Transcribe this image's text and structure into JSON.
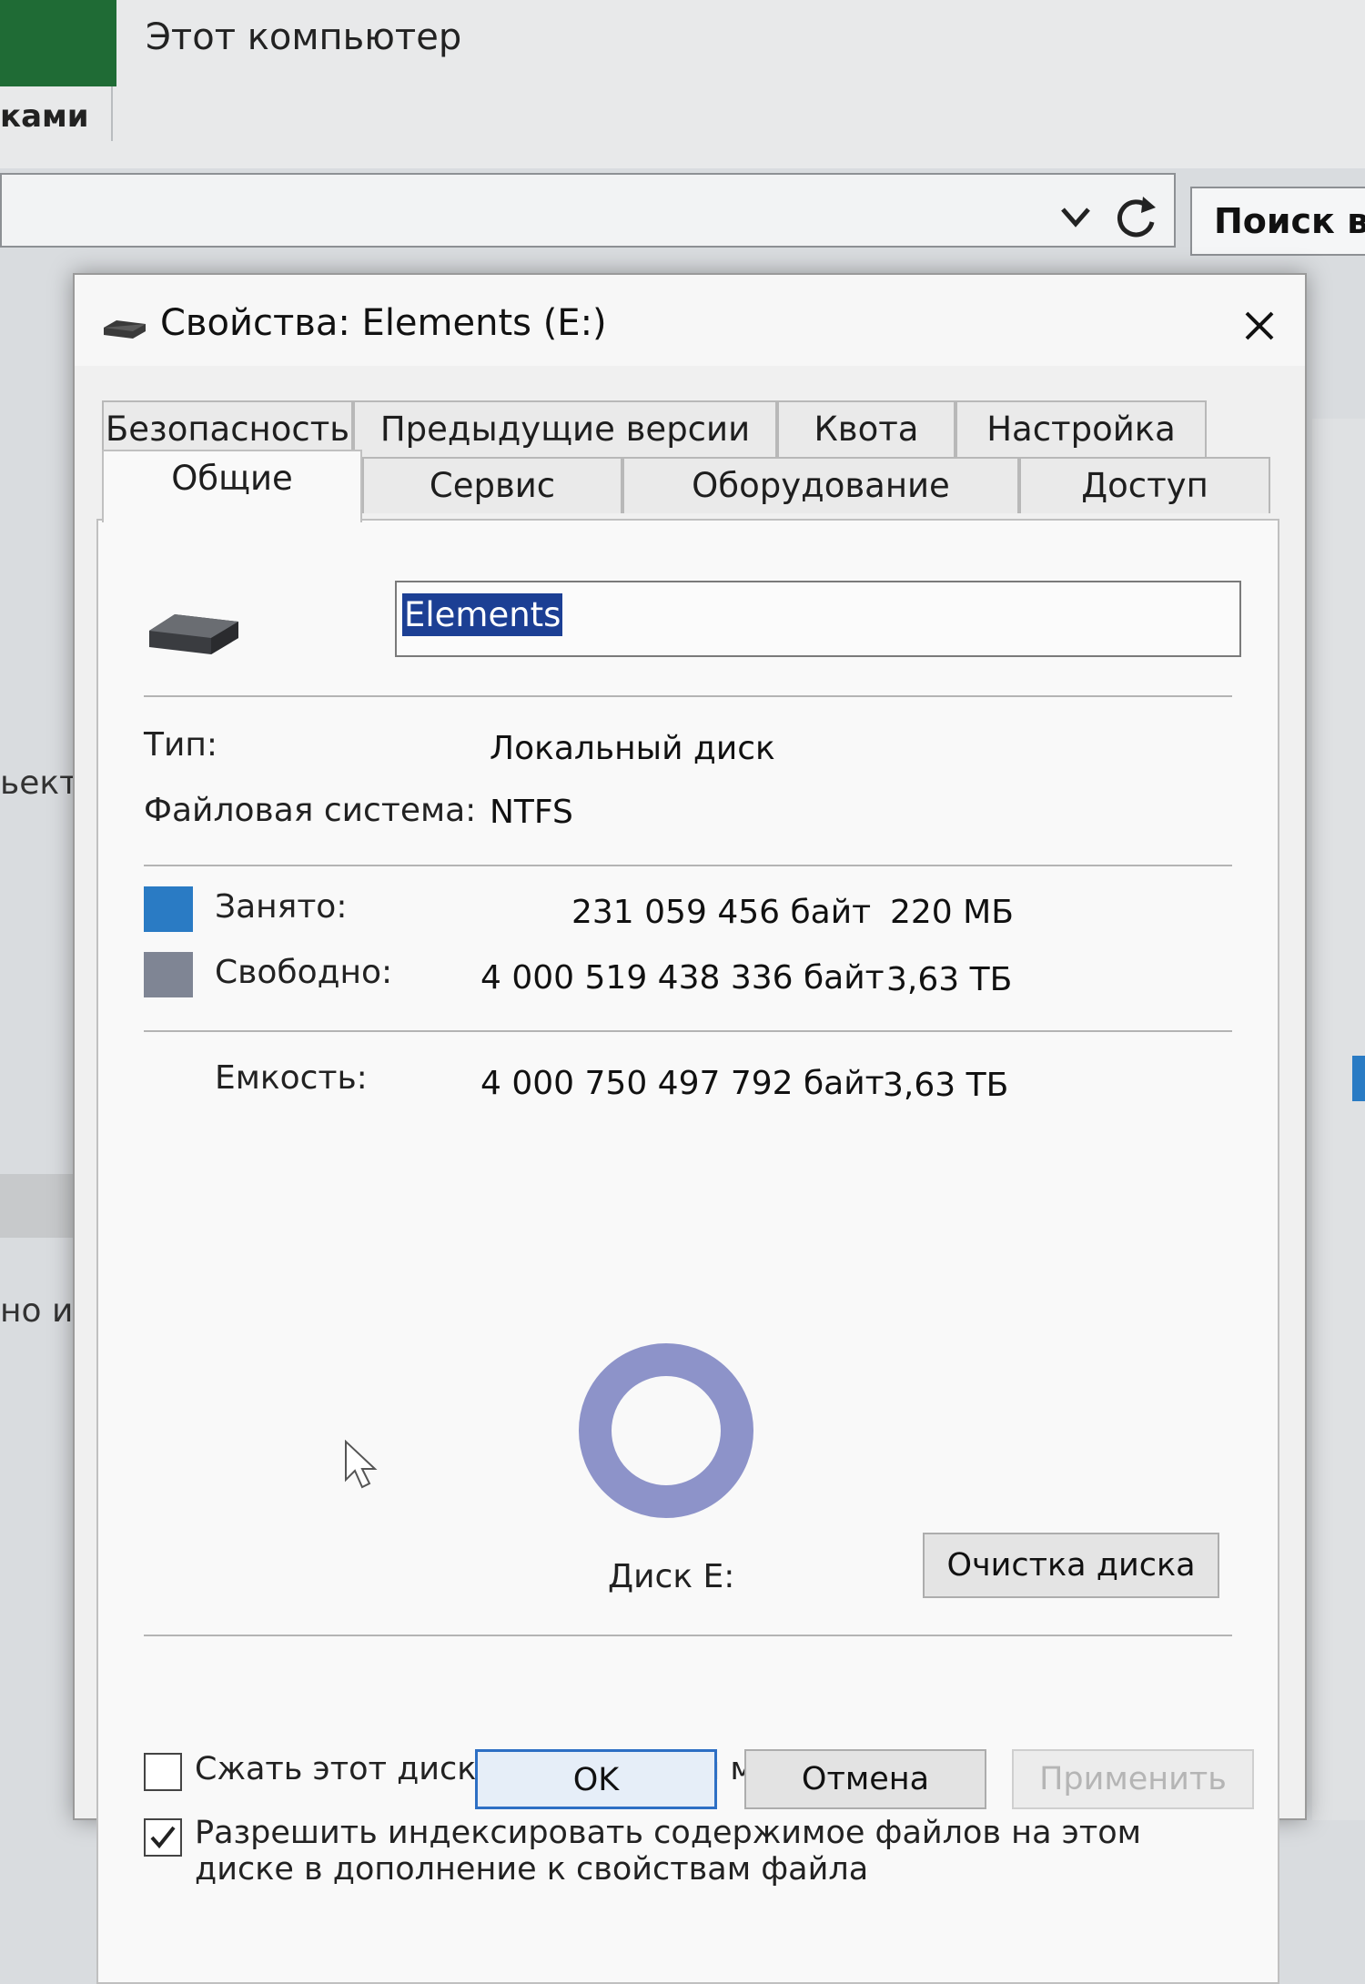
{
  "background": {
    "window_title": "Этот компьютер",
    "ribbon_tab_fragment": "ками",
    "search_placeholder": "Поиск в:",
    "left_fragment_1": "ьект",
    "left_fragment_2": "но и"
  },
  "dialog": {
    "title": "Свойства: Elements (E:)",
    "tabs_row1": [
      "Безопасность",
      "Предыдущие версии",
      "Квота",
      "Настройка"
    ],
    "tabs_row2": [
      "Общие",
      "Сервис",
      "Оборудование",
      "Доступ"
    ],
    "active_tab": "Общие",
    "volume_name": "Elements",
    "type_label": "Тип:",
    "type_value": "Локальный диск",
    "fs_label": "Файловая система:",
    "fs_value": "NTFS",
    "used": {
      "label": "Занято:",
      "bytes": "231 059 456 байт",
      "short": "220 МБ",
      "color": "#2a7bc4"
    },
    "free": {
      "label": "Свободно:",
      "bytes": "4 000 519 438 336 байт",
      "short": "3,63 ТБ",
      "color": "#7f8594"
    },
    "capacity": {
      "label": "Емкость:",
      "bytes": "4 000 750 497 792 байт",
      "short": "3,63 ТБ"
    },
    "disk_label": "Диск E:",
    "cleanup_button": "Очистка диска",
    "compress_label": "Сжать этот диск для экономии места",
    "compress_checked": false,
    "index_label_line1": "Разрешить индексировать содержимое файлов на этом",
    "index_label_line2": "диске в дополнение к свойствам файла",
    "index_checked": true,
    "ok_button": "OK",
    "cancel_button": "Отмена",
    "apply_button": "Применить"
  },
  "chart_data": {
    "type": "pie",
    "categories": [
      "Занято",
      "Свободно"
    ],
    "values": [
      231059456,
      4000519438336
    ],
    "colors": [
      "#2a7bc4",
      "#8d93c9"
    ]
  }
}
